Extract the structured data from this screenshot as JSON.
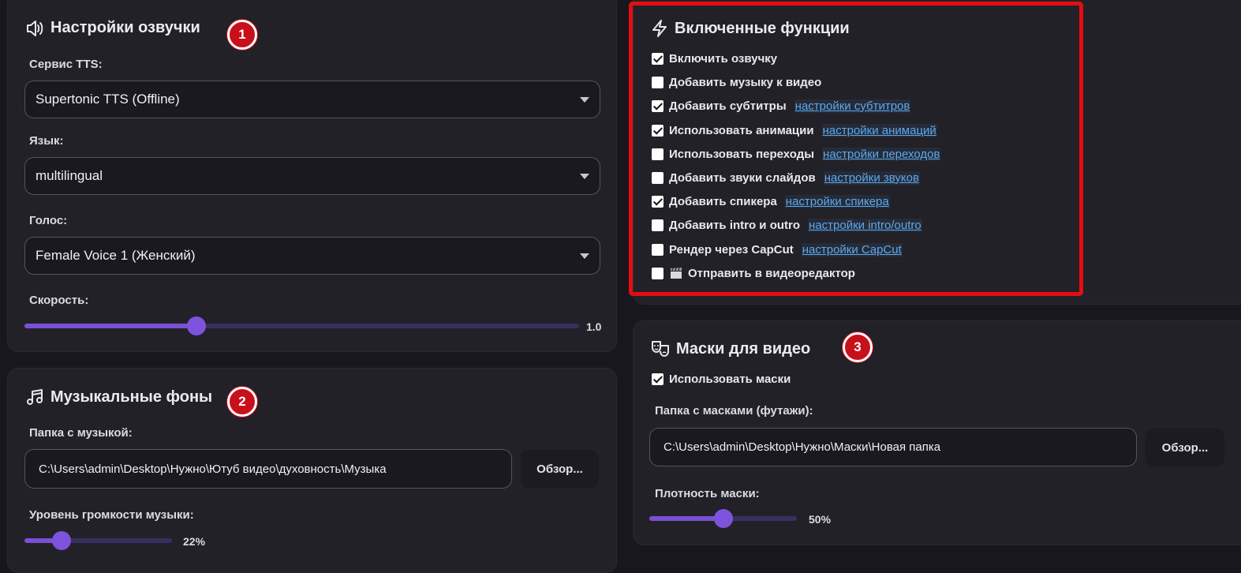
{
  "tts_panel": {
    "title": "Настройки озвучки",
    "service_label": "Сервис TTS:",
    "service_value": "Supertonic TTS (Offline)",
    "language_label": "Язык:",
    "language_value": "multilingual",
    "voice_label": "Голос:",
    "voice_value": "Female Voice 1 (Женский)",
    "speed_label": "Скорость:",
    "speed_value": "1.0",
    "speed_fraction": 0.31
  },
  "music_panel": {
    "title": "Музыкальные фоны",
    "folder_label": "Папка с музыкой:",
    "folder_value": "C:\\Users\\admin\\Desktop\\Нужно\\Ютуб видео\\духовность\\Музыка",
    "browse_label": "Обзор...",
    "volume_label": "Уровень громкости музыки:",
    "volume_value": "22%",
    "volume_fraction": 0.25
  },
  "features_panel": {
    "title": "Включенные функции",
    "items": [
      {
        "label": "Включить озвучку",
        "checked": true,
        "link": ""
      },
      {
        "label": "Добавить музыку к видео",
        "checked": false,
        "link": ""
      },
      {
        "label": "Добавить субтитры",
        "checked": true,
        "link": "настройки субтитров"
      },
      {
        "label": "Использовать анимации",
        "checked": true,
        "link": "настройки анимаций"
      },
      {
        "label": "Использовать переходы",
        "checked": false,
        "link": "настройки переходов"
      },
      {
        "label": "Добавить звуки слайдов",
        "checked": false,
        "link": "настройки звуков"
      },
      {
        "label": "Добавить спикера",
        "checked": true,
        "link": "настройки спикера"
      },
      {
        "label": "Добавить intro и outro",
        "checked": false,
        "link": "настройки intro/outro"
      },
      {
        "label": "Рендер через CapCut",
        "checked": false,
        "link": "настройки CapCut"
      },
      {
        "label": "Отправить в видеоредактор",
        "checked": false,
        "link": "",
        "icon": "clapperboard-icon"
      }
    ]
  },
  "masks_panel": {
    "title": "Маски для видео",
    "use_masks_label": "Использовать маски",
    "use_masks_checked": true,
    "folder_label": "Папка с масками (футажи):",
    "folder_value": "C:\\Users\\admin\\Desktop\\Нужно\\Маски\\Новая папка",
    "browse_label": "Обзор...",
    "density_label": "Плотность маски:",
    "density_value": "50%",
    "density_fraction": 0.5
  },
  "badges": {
    "one": "1",
    "two": "2",
    "three": "3"
  },
  "colors": {
    "background": "#18171d",
    "panel": "#222128",
    "accent": "#7a4fd6",
    "link": "#5aa9ef",
    "highlight": "#e50d12"
  }
}
